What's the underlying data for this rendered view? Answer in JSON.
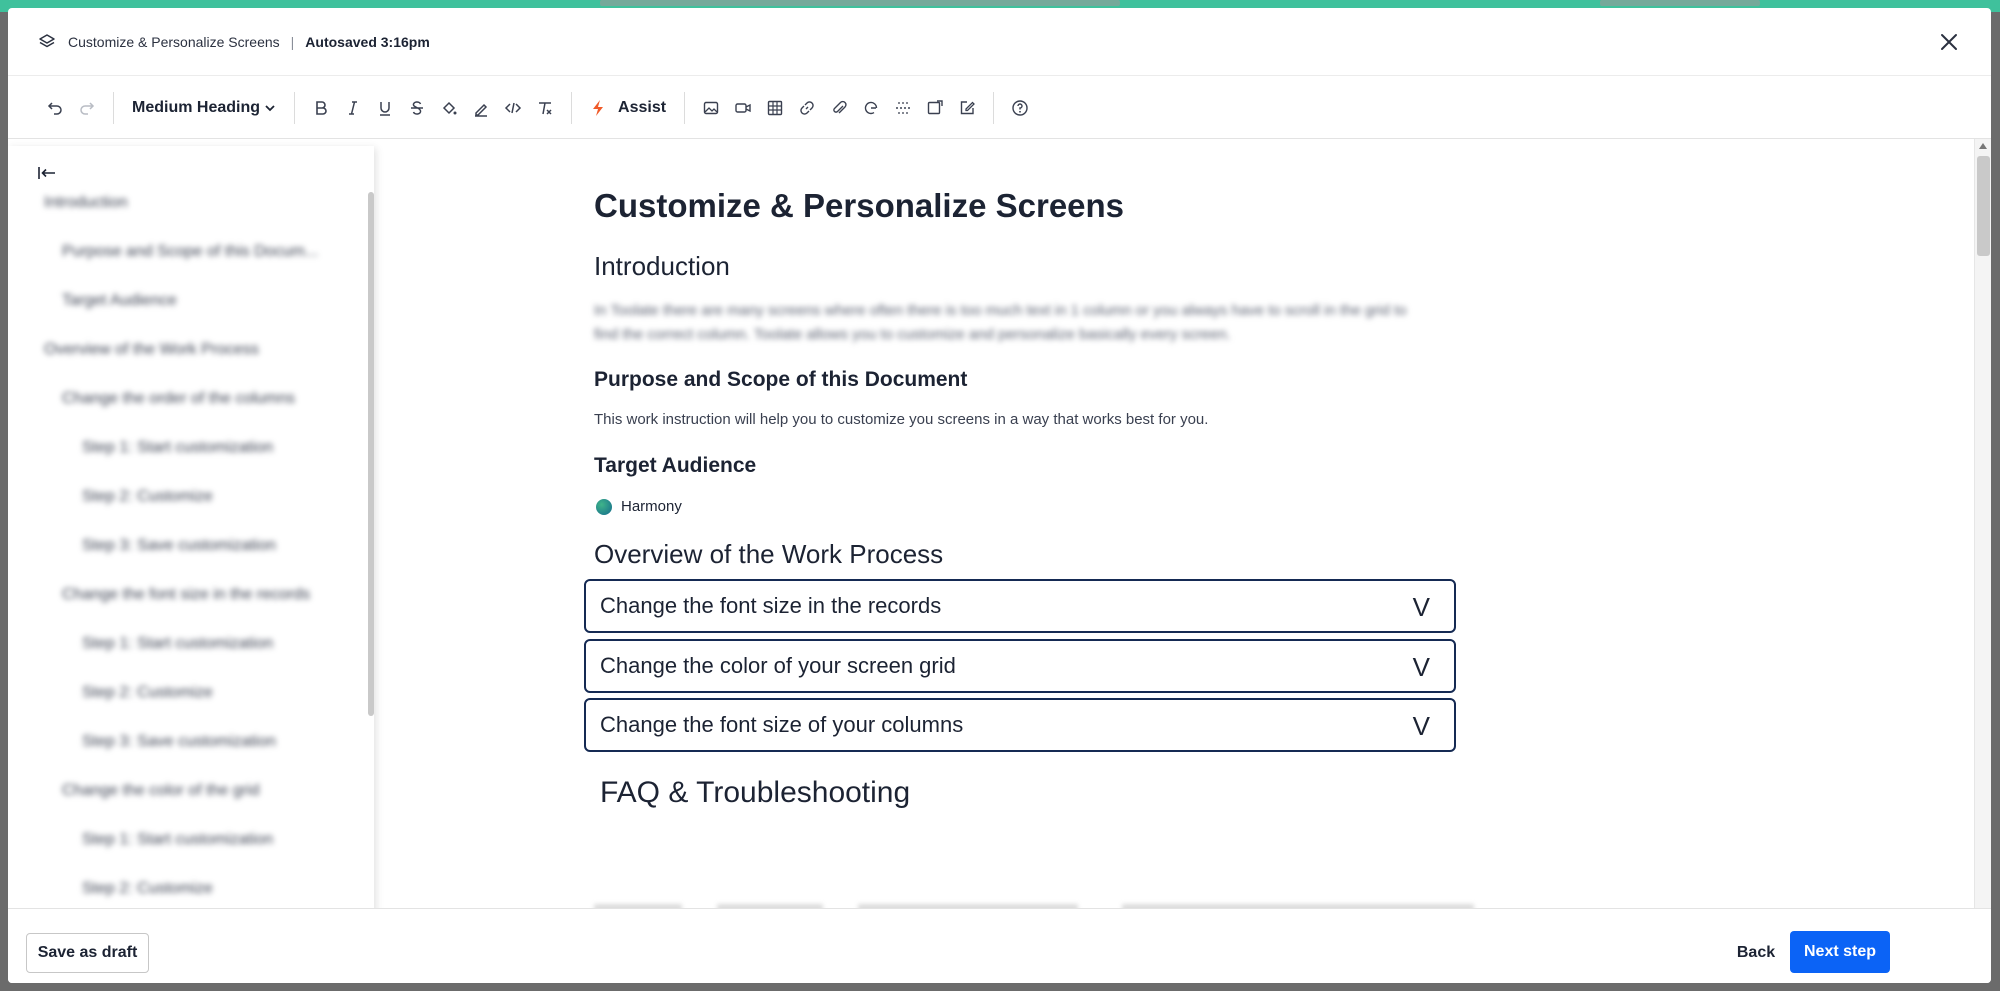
{
  "window": {
    "doc_name": "Customize & Personalize Screens",
    "separator": "|",
    "autosaved": "Autosaved 3:16pm"
  },
  "toolbar": {
    "heading_style": "Medium Heading",
    "assist_label": "Assist",
    "icons": [
      "undo-icon",
      "redo-icon",
      "bold-icon",
      "italic-icon",
      "underline-icon",
      "strikethrough-icon",
      "fill-color-icon",
      "highlight-icon",
      "code-icon",
      "clear-format-icon",
      "image-icon",
      "video-icon",
      "table-icon",
      "link-icon",
      "attachment-icon",
      "mention-icon",
      "divider-icon",
      "embed-icon",
      "edit-icon",
      "help-icon"
    ]
  },
  "sidebar": {
    "items": [
      {
        "label": "Introduction",
        "level": 0
      },
      {
        "label": "Purpose and Scope of this Docum...",
        "level": 1
      },
      {
        "label": "Target Audience",
        "level": 1
      },
      {
        "label": "Overview of the Work Process",
        "level": 0
      },
      {
        "label": "Change the order of the columns",
        "level": 1
      },
      {
        "label": "Step 1: Start customization",
        "level": 2
      },
      {
        "label": "Step 2: Customize",
        "level": 2
      },
      {
        "label": "Step 3: Save customization",
        "level": 2
      },
      {
        "label": "Change the font size in the records",
        "level": 1
      },
      {
        "label": "Step 1: Start customization",
        "level": 2
      },
      {
        "label": "Step 2: Customize",
        "level": 2
      },
      {
        "label": "Step 3: Save customization",
        "level": 2
      },
      {
        "label": "Change the color of the grid",
        "level": 1
      },
      {
        "label": "Step 1: Start customization",
        "level": 2
      },
      {
        "label": "Step 2: Customize",
        "level": 2
      }
    ]
  },
  "document": {
    "title": "Customize & Personalize Screens",
    "intro_heading": "Introduction",
    "intro_text": "In Toolate there are many screens where often there is too much text in 1 column or you always have to scroll in the grid to find the correct column. Toolate allows you to customize and personalize basically every screen.",
    "purpose_heading": "Purpose and Scope of this Document",
    "purpose_text": "This work instruction will help you to customize you screens in a way that works best for you.",
    "audience_heading": "Target Audience",
    "audience_chip": "Harmony",
    "overview_heading": "Overview of the Work Process",
    "accordion": [
      {
        "label": "Change the font size in the records",
        "chevron": "V"
      },
      {
        "label": "Change the color of your screen grid",
        "chevron": "V"
      },
      {
        "label": "Change the font size of your columns",
        "chevron": "V"
      }
    ],
    "faq_heading": "FAQ & Troubleshooting"
  },
  "footer": {
    "save_draft": "Save as draft",
    "back": "Back",
    "next": "Next step"
  },
  "colors": {
    "accent": "#0b63f6",
    "accordion_border": "#152a53",
    "assist_icon": "#f05a28",
    "top_strip": "#3fc19c"
  }
}
